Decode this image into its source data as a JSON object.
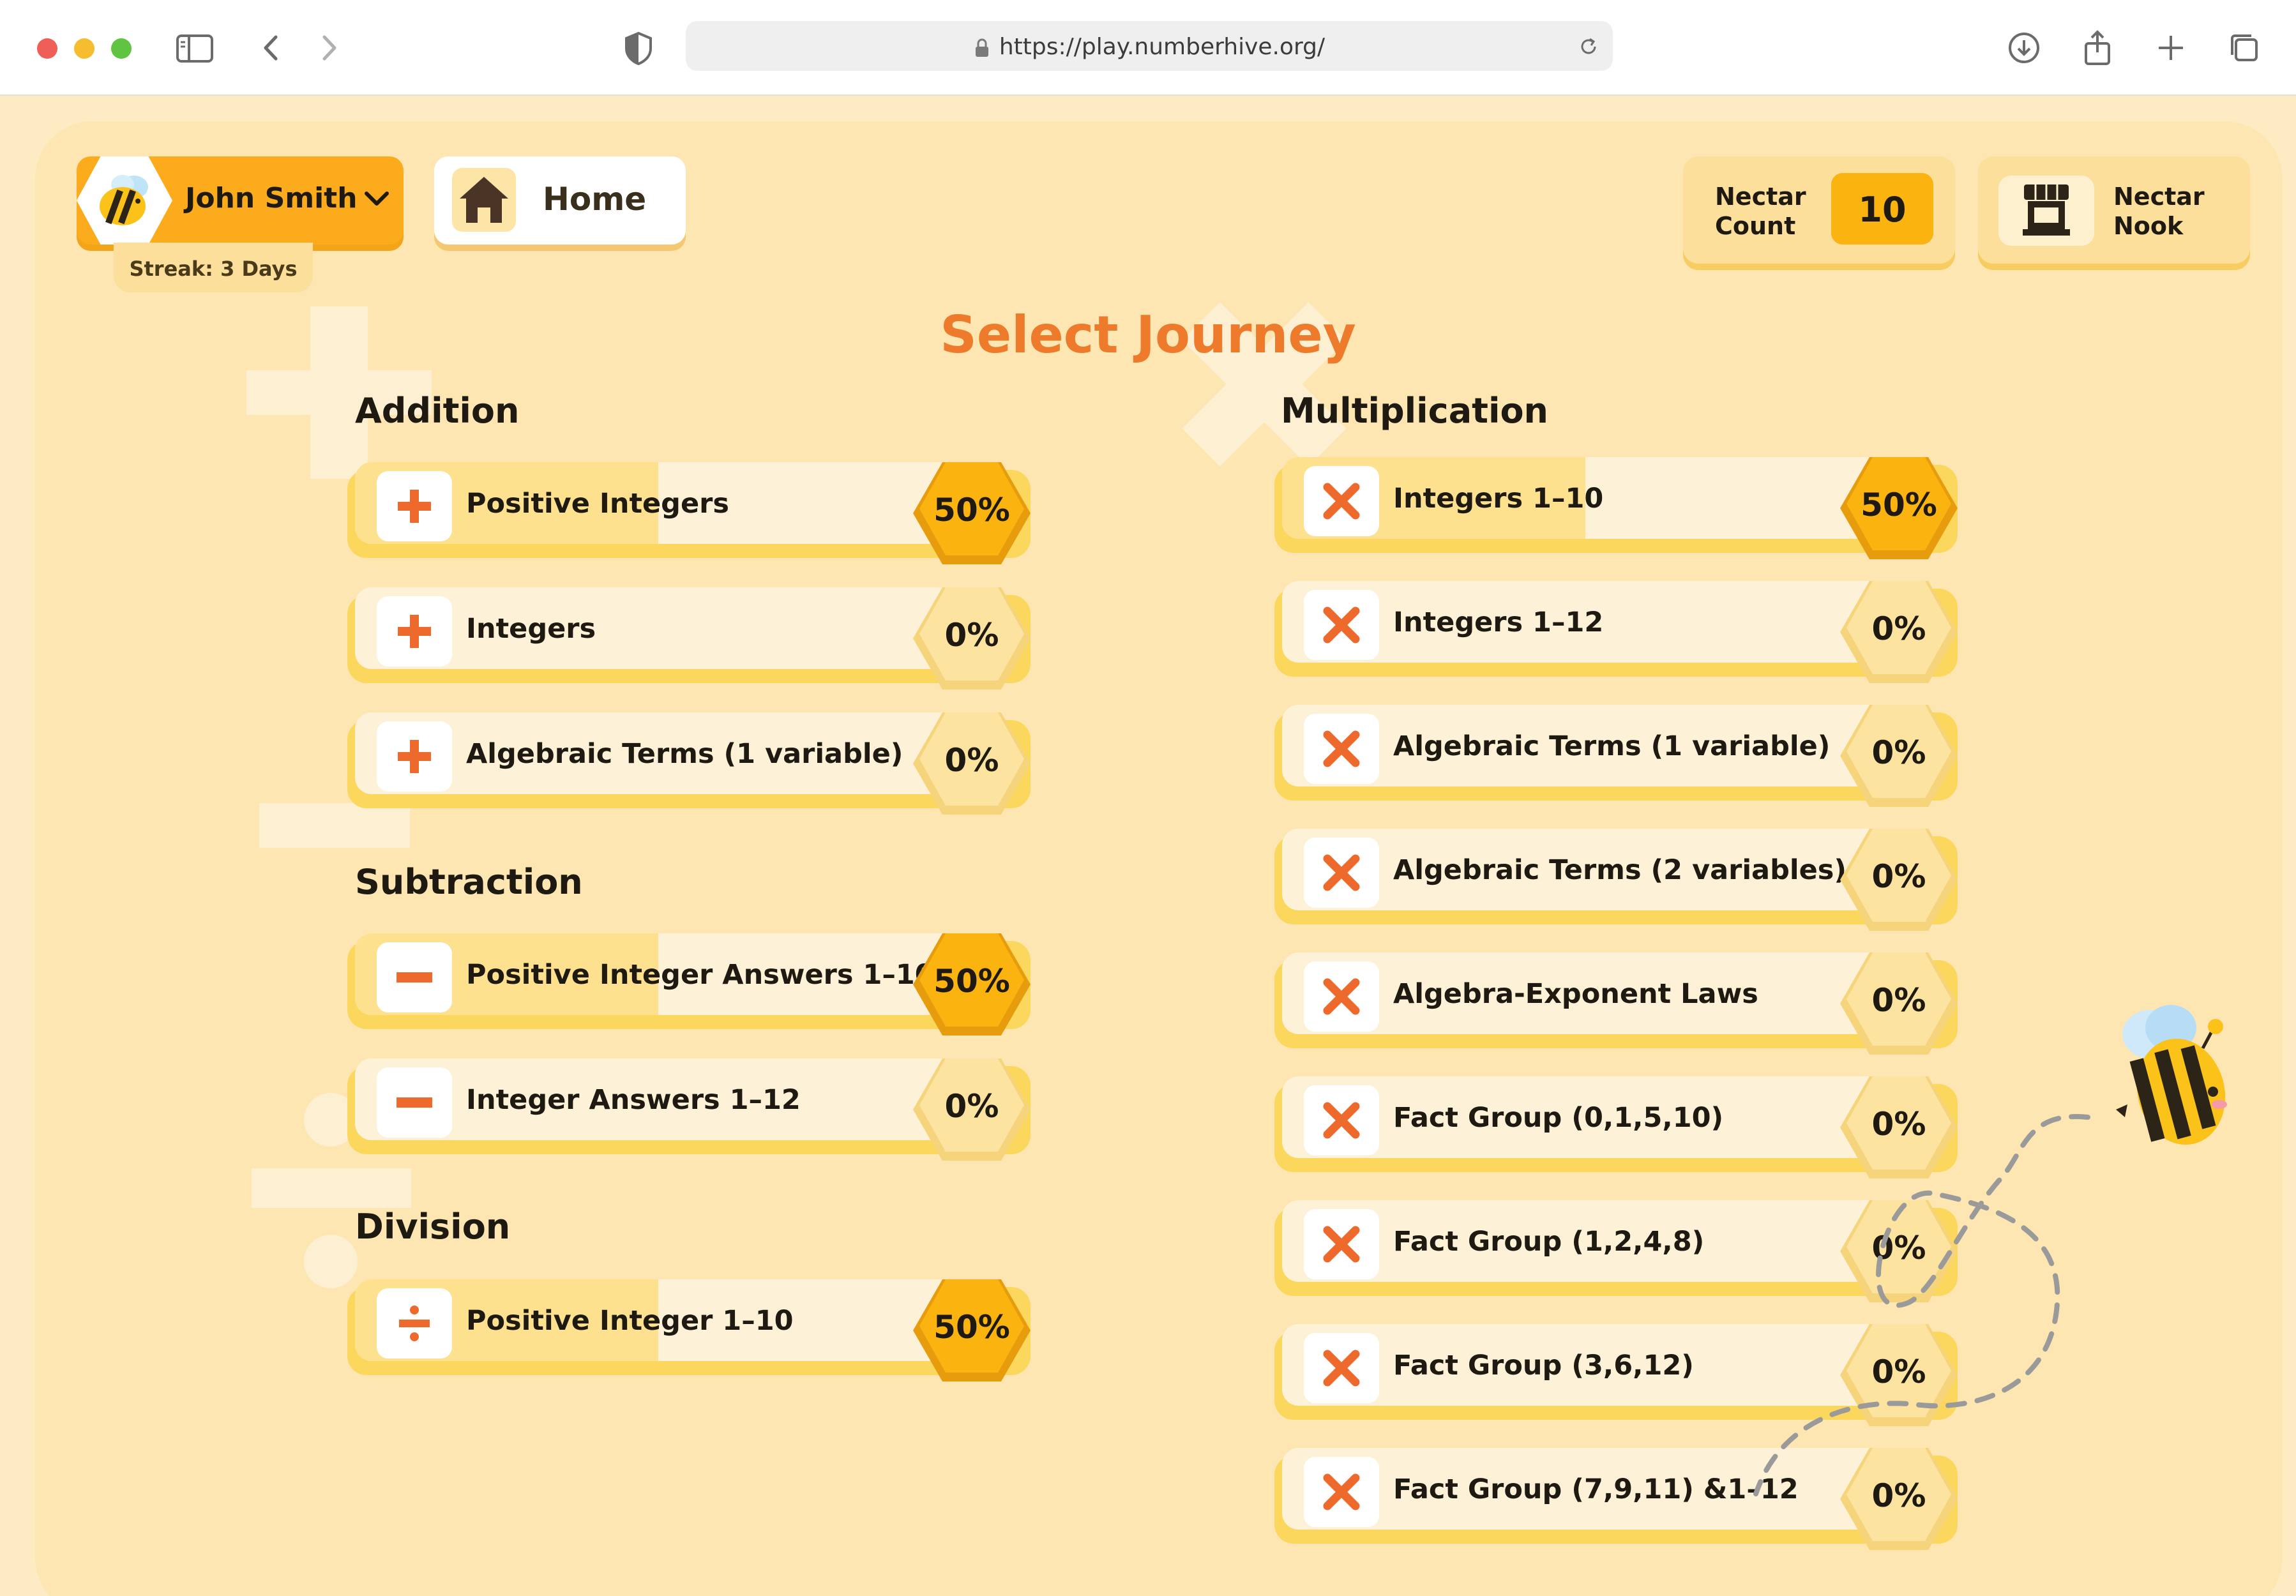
{
  "browser": {
    "url": "https://play.numberhive.org/"
  },
  "user": {
    "name": "John Smith",
    "streak": "Streak: 3 Days"
  },
  "nav": {
    "home_label": "Home"
  },
  "nectar": {
    "count_label_line1": "Nectar",
    "count_label_line2": "Count",
    "count_value": "10",
    "nook_label_line1": "Nectar",
    "nook_label_line2": "Nook"
  },
  "page_title": "Select Journey",
  "sections": {
    "addition": {
      "title": "Addition",
      "items": [
        {
          "label": "Positive Integers",
          "progress": "50%",
          "progress_value": 0.5
        },
        {
          "label": "Integers",
          "progress": "0%",
          "progress_value": 0
        },
        {
          "label": "Algebraic Terms (1 variable)",
          "progress": "0%",
          "progress_value": 0
        }
      ]
    },
    "subtraction": {
      "title": "Subtraction",
      "items": [
        {
          "label": "Positive Integer Answers 1–10",
          "progress": "50%",
          "progress_value": 0.5
        },
        {
          "label": "Integer Answers 1–12",
          "progress": "0%",
          "progress_value": 0
        }
      ]
    },
    "division": {
      "title": "Division",
      "items": [
        {
          "label": "Positive Integer 1–10",
          "progress": "50%",
          "progress_value": 0.5
        }
      ]
    },
    "multiplication": {
      "title": "Multiplication",
      "items": [
        {
          "label": "Integers 1–10",
          "progress": "50%",
          "progress_value": 0.5
        },
        {
          "label": "Integers 1–12",
          "progress": "0%",
          "progress_value": 0
        },
        {
          "label": "Algebraic Terms (1 variable)",
          "progress": "0%",
          "progress_value": 0
        },
        {
          "label": "Algebraic Terms (2 variables)",
          "progress": "0%",
          "progress_value": 0
        },
        {
          "label": "Algebra-Exponent Laws",
          "progress": "0%",
          "progress_value": 0
        },
        {
          "label": "Fact Group (0,1,5,10)",
          "progress": "0%",
          "progress_value": 0
        },
        {
          "label": "Fact Group (1,2,4,8)",
          "progress": "0%",
          "progress_value": 0
        },
        {
          "label": "Fact Group (3,6,12)",
          "progress": "0%",
          "progress_value": 0
        },
        {
          "label": "Fact Group (7,9,11) &1–12",
          "progress": "0%",
          "progress_value": 0
        }
      ]
    }
  },
  "icons": {
    "addition": "plus-icon",
    "subtraction": "minus-icon",
    "division": "divide-icon",
    "multiplication": "times-icon"
  },
  "colors": {
    "accent": "#ee7a2c",
    "panel": "#fde6b1",
    "progress_done": "#fbb40f",
    "progress_todo": "#fde3a0"
  }
}
